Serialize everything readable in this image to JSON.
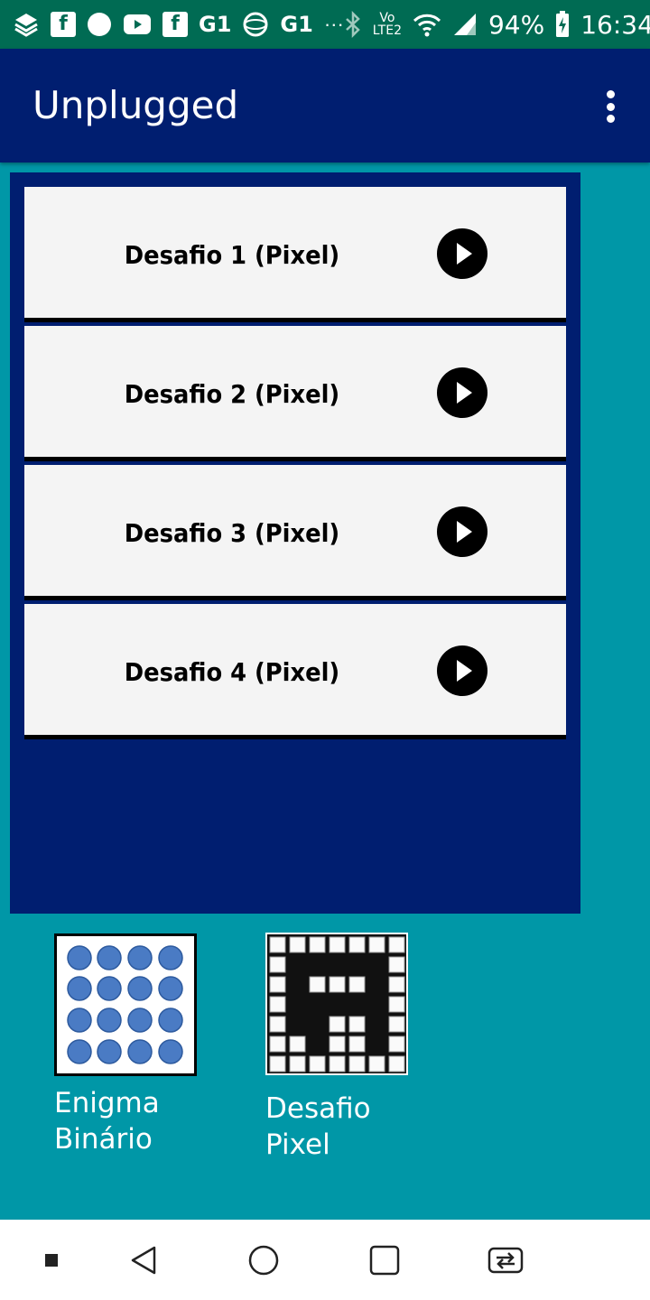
{
  "status_bar": {
    "battery": "94%",
    "time": "16:34",
    "network": "LTE2",
    "vo": "Vo",
    "notif_icons": [
      "layers-icon",
      "facebook-icon",
      "circle-icon",
      "youtube-icon",
      "facebook-icon",
      "g1-icon",
      "globe-icon",
      "g1-icon",
      "more-icon"
    ],
    "g1_label": "G1",
    "fb_label": "f",
    "more_label": "···"
  },
  "app_bar": {
    "title": "Unplugged"
  },
  "challenges": [
    {
      "label": "Desafio 1 (Pixel)"
    },
    {
      "label": "Desafio 2 (Pixel)"
    },
    {
      "label": "Desafio 3 (Pixel)"
    },
    {
      "label": "Desafio 4 (Pixel)"
    }
  ],
  "apps": [
    {
      "label": "Enigma\nBinário",
      "icon": "binary-dots-icon"
    },
    {
      "label": "Desafio\nPixel",
      "icon": "pixel-grid-icon"
    }
  ],
  "colors": {
    "status_bar": "#006b53",
    "app_bar": "#001e70",
    "background": "#0097a7",
    "card": "#f4f4f4"
  }
}
